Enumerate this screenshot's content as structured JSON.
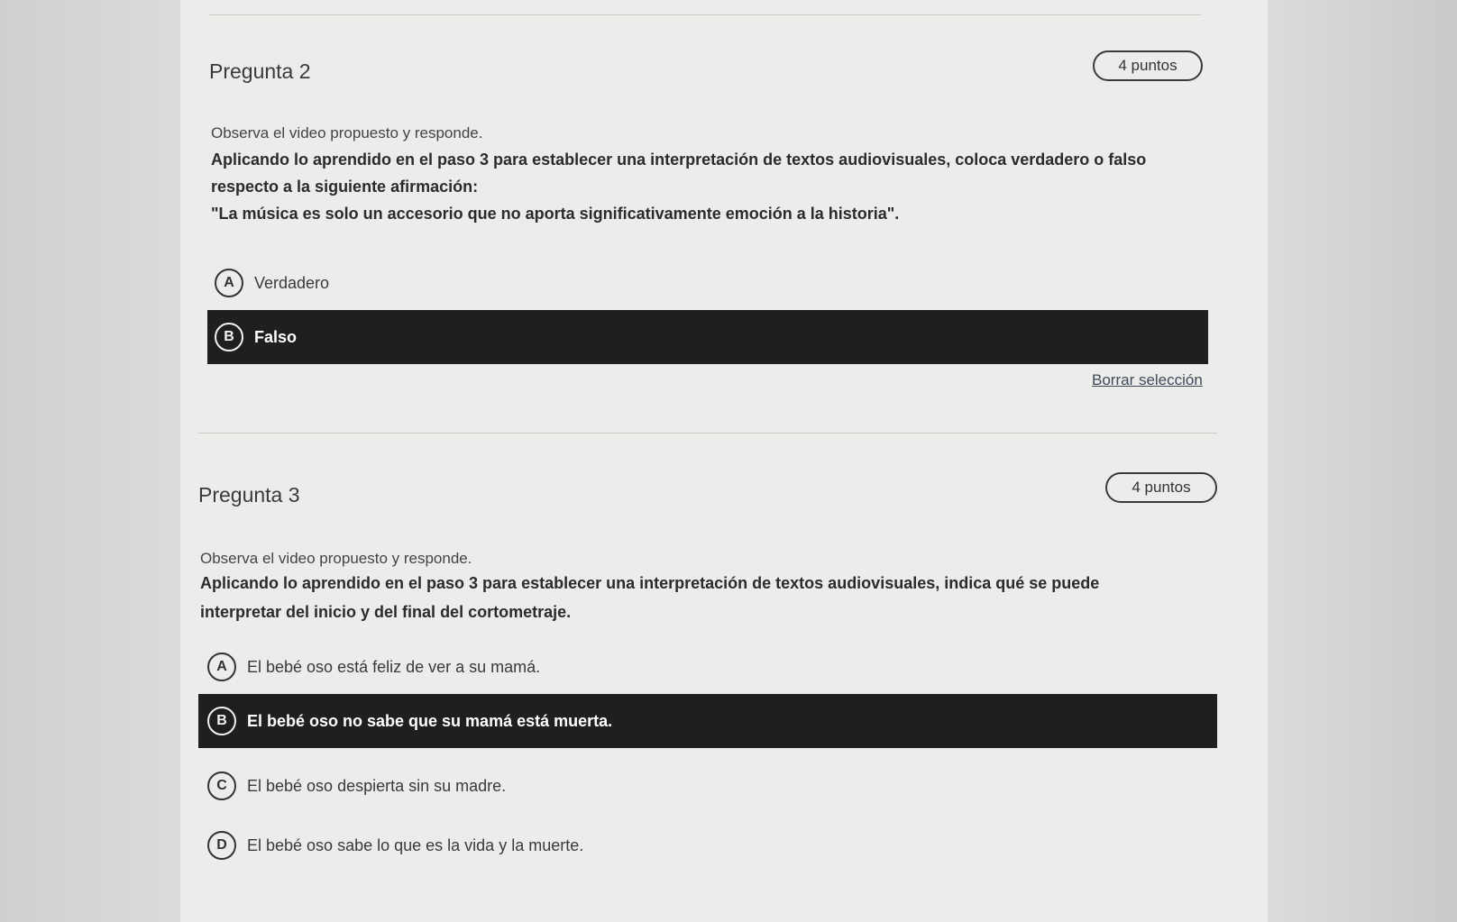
{
  "questions": [
    {
      "title": "Pregunta 2",
      "points": "4 puntos",
      "instruction": "Observa el video propuesto y responde.",
      "statement_lines": [
        "Aplicando lo aprendido en el paso 3 para establecer una interpretación de textos audiovisuales, coloca verdadero o falso",
        "respecto a la siguiente afirmación:",
        "\"La música es solo un accesorio que no aporta significativamente emoción a la historia\"."
      ],
      "options": [
        {
          "letter": "A",
          "text": "Verdadero",
          "selected": false
        },
        {
          "letter": "B",
          "text": "Falso",
          "selected": true
        }
      ],
      "clear_label": "Borrar selección"
    },
    {
      "title": "Pregunta 3",
      "points": "4 puntos",
      "instruction": "Observa el video propuesto y responde.",
      "statement_lines": [
        "Aplicando lo aprendido en el paso 3 para establecer una interpretación de textos audiovisuales, indica qué se puede",
        "interpretar del inicio y del final del cortometraje."
      ],
      "options": [
        {
          "letter": "A",
          "text": "El bebé oso está feliz de ver a su mamá.",
          "selected": false
        },
        {
          "letter": "B",
          "text": "El bebé oso no sabe que su mamá está muerta.",
          "selected": true
        },
        {
          "letter": "C",
          "text": "El bebé oso despierta sin su madre.",
          "selected": false
        },
        {
          "letter": "D",
          "text": "El bebé oso sabe lo que es la vida y la muerte.",
          "selected": false
        }
      ]
    }
  ]
}
